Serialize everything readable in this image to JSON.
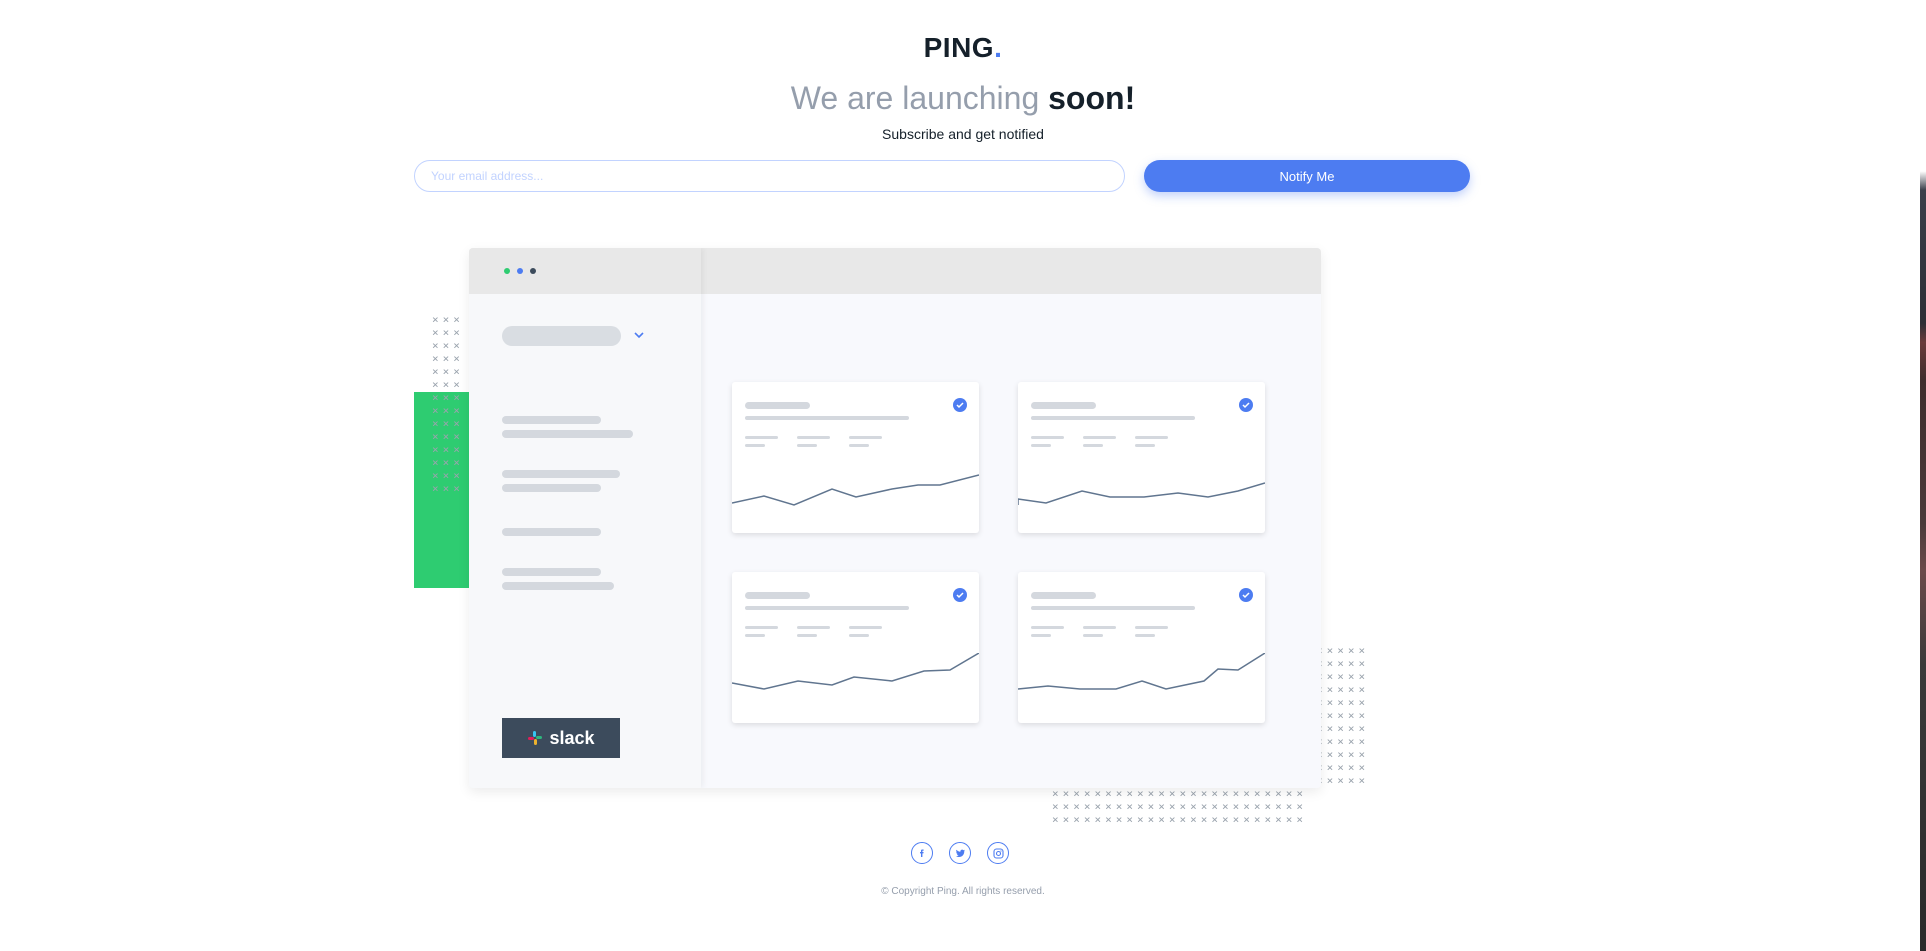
{
  "brand": {
    "name": "PING",
    "dot": ".",
    "accent": "#4d7cf1"
  },
  "hero": {
    "headline_light": "We are launching",
    "headline_bold": "soon!",
    "subline": "Subscribe and get notified"
  },
  "form": {
    "email_placeholder": "Your email address...",
    "submit_label": "Notify Me"
  },
  "illustration": {
    "window_dots": [
      "#2ecc71",
      "#4d7cf1",
      "#3c4b5c"
    ],
    "slack_label": "slack",
    "cards": [
      {
        "name": "dashboard-card-1",
        "check_icon": "check-circle-icon"
      },
      {
        "name": "dashboard-card-2",
        "check_icon": "check-circle-icon"
      },
      {
        "name": "dashboard-card-3",
        "check_icon": "check-circle-icon"
      },
      {
        "name": "dashboard-card-4",
        "check_icon": "check-circle-icon"
      }
    ]
  },
  "social": [
    {
      "name": "facebook-icon"
    },
    {
      "name": "twitter-icon"
    },
    {
      "name": "instagram-icon"
    }
  ],
  "footer": {
    "copyright": "© Copyright Ping. All rights reserved."
  },
  "colors": {
    "primary": "#4d7cf1",
    "dark": "#15202a",
    "gray": "#959eac",
    "green": "#2ecc71"
  }
}
